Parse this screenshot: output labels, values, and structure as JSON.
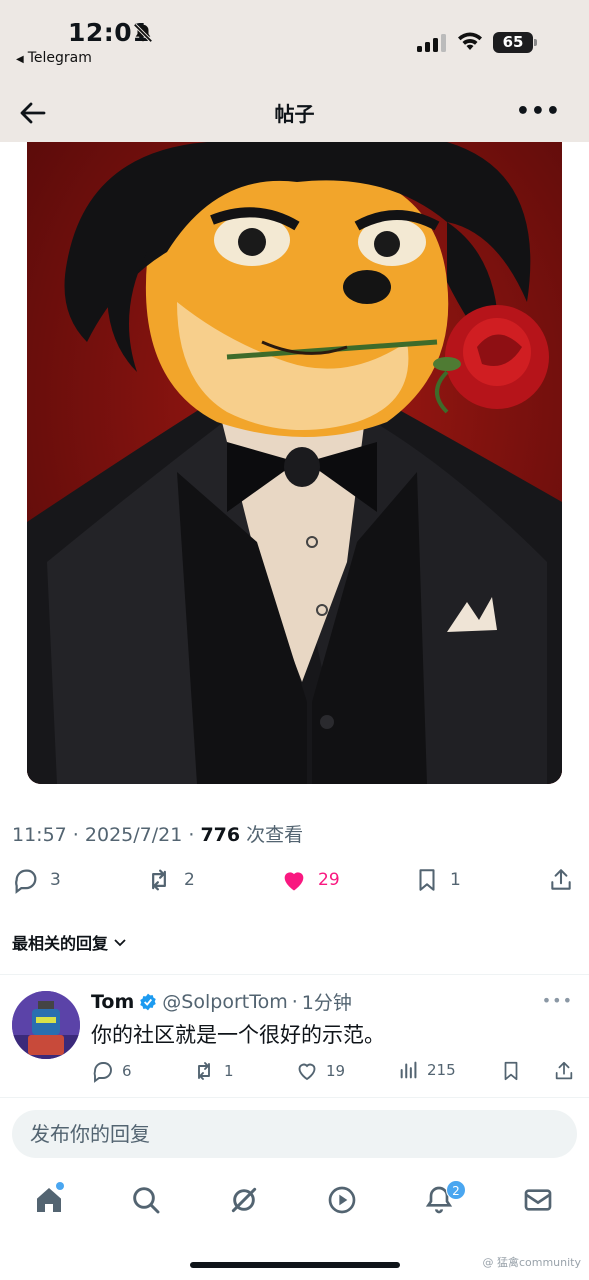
{
  "status_bar": {
    "time": "12:01",
    "back_app": "Telegram",
    "battery": "65"
  },
  "nav": {
    "title": "帖子"
  },
  "post": {
    "time": "11:57",
    "date": "2025/7/21",
    "views_count": "776",
    "views_label": "次查看",
    "stats": {
      "replies": "3",
      "reposts": "2",
      "likes": "29",
      "bookmarks": "1"
    }
  },
  "replies_sort": "最相关的回复",
  "reply": {
    "name": "Tom",
    "handle": "@SolportTom",
    "time": "1分钟",
    "text": "你的社区就是一个很好的示范。",
    "stats": {
      "replies": "6",
      "reposts": "1",
      "likes": "19",
      "views": "215"
    }
  },
  "compose": {
    "placeholder": "发布你的回复"
  },
  "tabbar": {
    "notifications_badge": "2"
  },
  "watermark": "@ 猛禽community",
  "colors": {
    "like": "#f91880",
    "accent": "#1d9bf0",
    "status_bg": "#ede8e4"
  }
}
